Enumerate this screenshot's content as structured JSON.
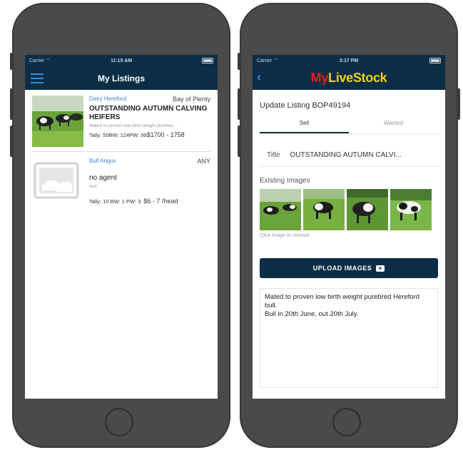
{
  "status": {
    "left": {
      "carrier": "Carrier",
      "time": "11:15 AM"
    },
    "right": {
      "carrier": "Carrier",
      "time": "3:17 PM"
    }
  },
  "left_screen": {
    "nav_title": "My Listings",
    "listings": [
      {
        "breed": "Dairy Hereford",
        "region": "Bay of Plenty",
        "title": "OUTSTANDING AUTUMN CALVING HEIFERS",
        "description": "Mated to proven low birth weight purebre...",
        "stats": "Tally: 50BW: 124PW: 99",
        "price": "$1700 - 1758"
      },
      {
        "breed": "Bull Angus",
        "region": "ANY",
        "title": "no agent",
        "description": "test",
        "stats": "Tally: 10  BW: 1  PW: 3",
        "price": "$6 - 7 /head"
      }
    ]
  },
  "right_screen": {
    "brand_my": "My",
    "brand_rest": "LiveStock",
    "heading": "Update Listing BOP49194",
    "tabs": [
      {
        "label": "Sell",
        "active": true
      },
      {
        "label": "Wanted",
        "active": false
      }
    ],
    "title_field": {
      "label": "Title",
      "value": "OUTSTANDING AUTUMN CALVI..."
    },
    "images_label": "Existing Images",
    "images_hint": "Click image to remove",
    "upload_label": "UPLOAD IMAGES",
    "description": "Mated to proven low birth weight purebred Hereford bull.\nBull in 20th June, out 20th July."
  },
  "colors": {
    "navbar": "#0b2d46",
    "accent_blue": "#2f8fe0",
    "brand_red": "#e02020",
    "brand_yellow": "#f2d21c",
    "phone_body": "#4a4a4a"
  }
}
